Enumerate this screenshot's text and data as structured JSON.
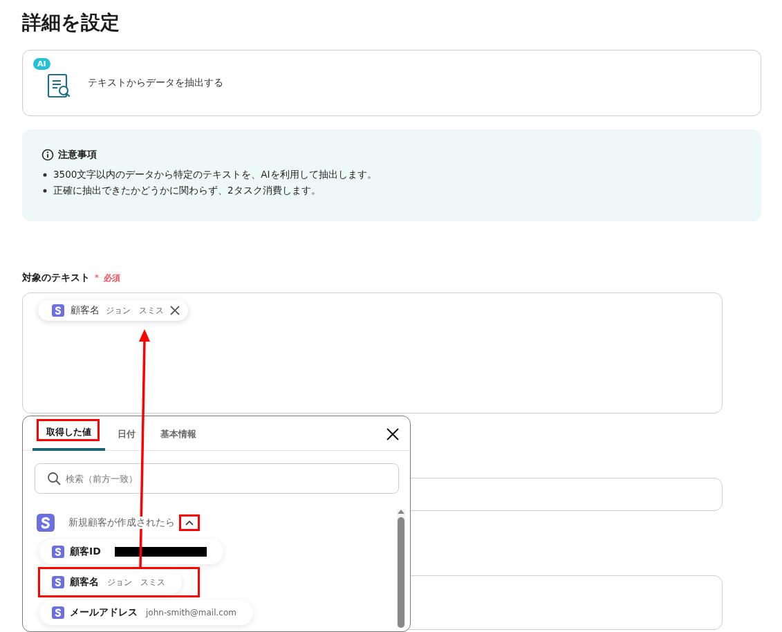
{
  "page_title": "詳細を設定",
  "action_card": {
    "badge": "AI",
    "label": "テキストからデータを抽出する"
  },
  "notice": {
    "title": "注意事項",
    "items": [
      "3500文字以内のデータから特定のテキストを、AIを利用して抽出します。",
      "正確に抽出できたかどうかに関わらず、2タスク消費します。"
    ]
  },
  "target_field": {
    "label": "対象のテキスト",
    "required_mark": "＊",
    "required_text": "必須",
    "chips": [
      {
        "name": "顧客名",
        "value": "ジョン　スミス"
      }
    ]
  },
  "picker": {
    "tabs": [
      {
        "label": "取得した値",
        "selected": true,
        "highlighted": true
      },
      {
        "label": "日付",
        "selected": false,
        "highlighted": false
      },
      {
        "label": "基本情報",
        "selected": false,
        "highlighted": false
      }
    ],
    "search": {
      "placeholder": "検索（前方一致）"
    },
    "group": {
      "title": "新規顧客が作成されたら",
      "expanded": true,
      "highlighted": true,
      "items": [
        {
          "name": "顧客ID",
          "redacted": true,
          "highlighted": false
        },
        {
          "name": "顧客名",
          "value": "ジョン　スミス",
          "redacted": false,
          "highlighted": true
        },
        {
          "name": "メールアドレス",
          "value": "john-smith@mail.com",
          "redacted": false,
          "highlighted": false
        }
      ]
    }
  },
  "annotation_arrow": true
}
